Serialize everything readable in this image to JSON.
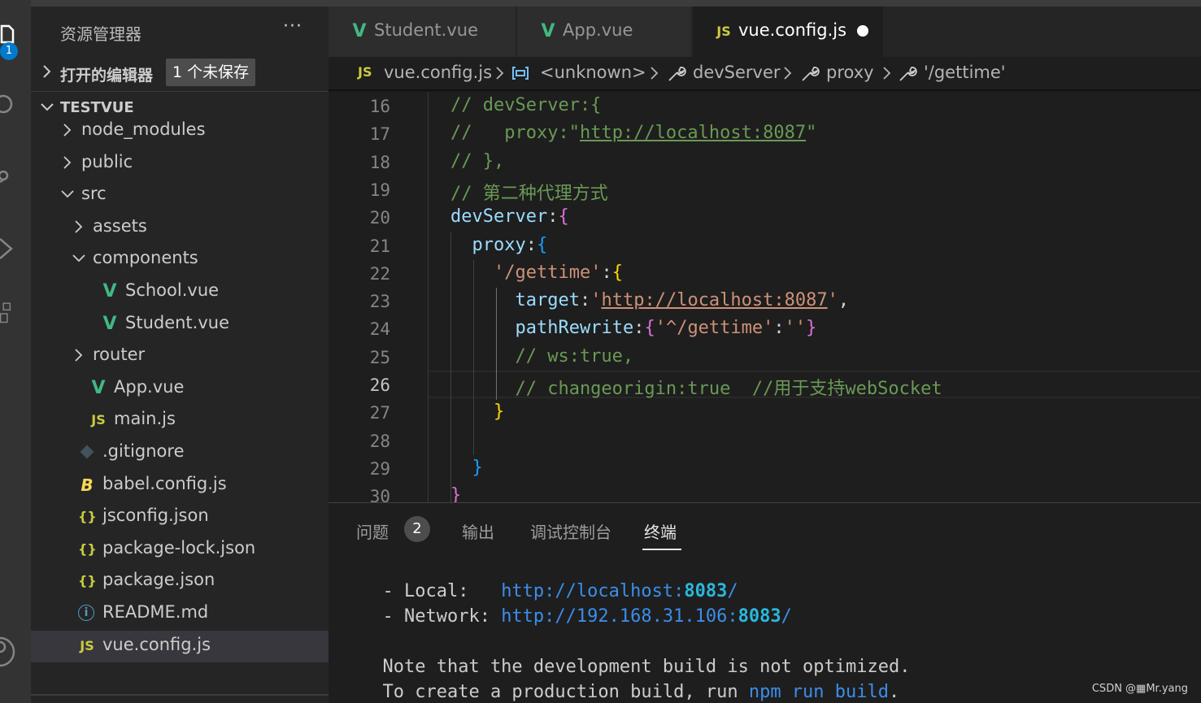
{
  "explorer": {
    "title": "资源管理器",
    "more": "···",
    "open_editors_label": "打开的编辑器",
    "unsaved_badge": "1 个未保存",
    "project_name": "TESTVUE",
    "tree": [
      {
        "name": "node_modules",
        "type": "folder",
        "expanded": false
      },
      {
        "name": "public",
        "type": "folder",
        "expanded": false
      },
      {
        "name": "src",
        "type": "folder",
        "expanded": true
      },
      {
        "name": "assets",
        "type": "folder",
        "expanded": false
      },
      {
        "name": "components",
        "type": "folder",
        "expanded": true
      },
      {
        "name": "School.vue",
        "type": "vue"
      },
      {
        "name": "Student.vue",
        "type": "vue"
      },
      {
        "name": "router",
        "type": "folder",
        "expanded": false
      },
      {
        "name": "App.vue",
        "type": "vue"
      },
      {
        "name": "main.js",
        "type": "js"
      },
      {
        "name": ".gitignore",
        "type": "git"
      },
      {
        "name": "babel.config.js",
        "type": "babel"
      },
      {
        "name": "jsconfig.json",
        "type": "json"
      },
      {
        "name": "package-lock.json",
        "type": "json"
      },
      {
        "name": "package.json",
        "type": "json"
      },
      {
        "name": "README.md",
        "type": "info"
      },
      {
        "name": "vue.config.js",
        "type": "js",
        "selected": true
      }
    ]
  },
  "activity_bar": {
    "badge": "1"
  },
  "tabs": [
    {
      "label": "Student.vue",
      "icon": "vue-icon",
      "active": false
    },
    {
      "label": "App.vue",
      "icon": "vue-icon",
      "active": false
    },
    {
      "label": "vue.config.js",
      "icon": "js-icon",
      "active": true,
      "unsaved": true
    }
  ],
  "icons": {
    "js": "JS",
    "vue": "V",
    "json": "{}",
    "babel": "B",
    "info": "i"
  },
  "breadcrumb": {
    "file": "vue.config.js",
    "items": [
      "<unknown>",
      "devServer",
      "proxy",
      "'/gettime'"
    ]
  },
  "editor": {
    "current_line": 26,
    "line_numbers": [
      16,
      17,
      18,
      19,
      20,
      21,
      22,
      23,
      24,
      25,
      26,
      27,
      28,
      29,
      30
    ],
    "lines": [
      "// devServer:{",
      "//   proxy:\"http://localhost:8087\"",
      "// },",
      "// 第二种代理方式",
      "devServer:{",
      "  proxy:{",
      "    '/gettime':{",
      "      target:'http://localhost:8087',",
      "      pathRewrite:{'^/gettime':''}",
      "      // ws:true,",
      "      // changeorigin:true  //用于支持webSocket",
      "    }",
      "",
      "  }",
      "}"
    ]
  },
  "panel": {
    "tabs": [
      "问题",
      "输出",
      "调试控制台",
      "终端"
    ],
    "problems_count": "2",
    "active_tab": "终端",
    "terminal": {
      "local_label": "  - Local:   ",
      "local_url_prefix": "http://localhost:",
      "local_port": "8083",
      "local_url_suffix": "/",
      "network_label": "  - Network: ",
      "network_url_prefix": "http://192.168.31.106:",
      "network_port": "8083",
      "network_url_suffix": "/",
      "note": "  Note that the development build is not optimized.",
      "build_prefix": "  To create a production build, run ",
      "build_cmd": "npm run build",
      "build_suffix": "."
    }
  },
  "watermark": "CSDN @▦Mr.yang",
  "colors": {
    "vue_green": "#41b883",
    "js_yellow": "#cbcb41",
    "json_yellow": "#cbcb41",
    "info_blue": "#519aba",
    "git_gray": "#41535b",
    "accent_blue": "#007acc"
  }
}
